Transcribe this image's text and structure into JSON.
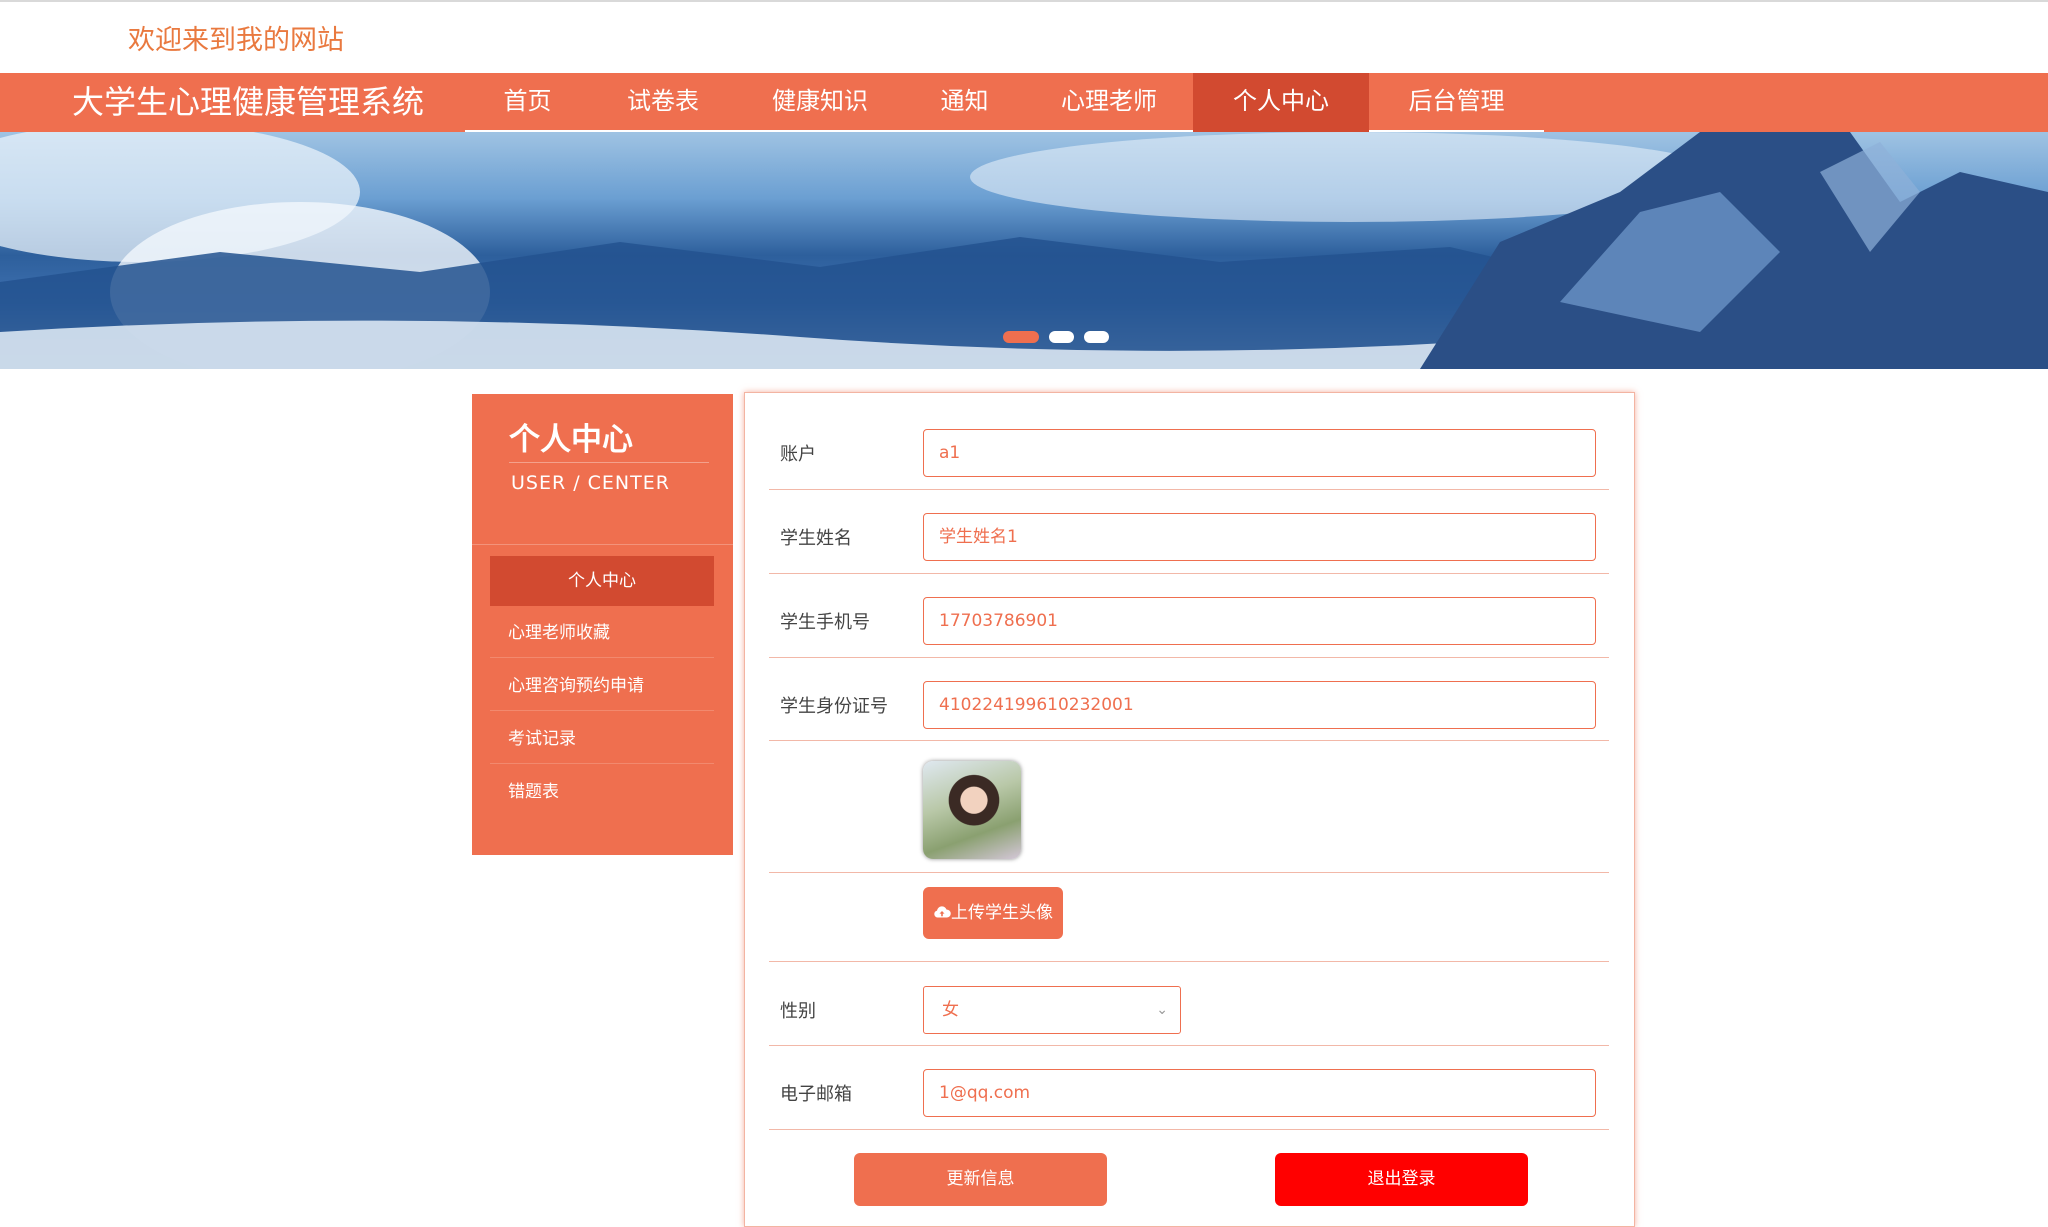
{
  "header": {
    "welcome": "欢迎来到我的网站",
    "system_title": "大学生心理健康管理系统"
  },
  "nav": {
    "items": [
      {
        "label": "首页"
      },
      {
        "label": "试卷表"
      },
      {
        "label": "健康知识"
      },
      {
        "label": "通知"
      },
      {
        "label": "心理老师"
      },
      {
        "label": "个人中心",
        "active": true
      },
      {
        "label": "后台管理"
      }
    ]
  },
  "banner": {
    "slides_count": 3,
    "active_slide": 1
  },
  "sidebar": {
    "title": "个人中心",
    "subtitle": "USER / CENTER",
    "items": [
      {
        "label": "个人中心",
        "active": true
      },
      {
        "label": "心理老师收藏"
      },
      {
        "label": "心理咨询预约申请"
      },
      {
        "label": "考试记录"
      },
      {
        "label": "错题表"
      }
    ]
  },
  "form": {
    "account": {
      "label": "账户",
      "value": "a1"
    },
    "name": {
      "label": "学生姓名",
      "value": "学生姓名1"
    },
    "phone": {
      "label": "学生手机号",
      "value": "17703786901"
    },
    "id_card": {
      "label": "学生身份证号",
      "value": "410224199610232001"
    },
    "upload_label": "上传学生头像",
    "gender": {
      "label": "性别",
      "value": "女"
    },
    "email": {
      "label": "电子邮箱",
      "value": "1@qq.com"
    },
    "update_button": "更新信息",
    "logout_button": "退出登录"
  },
  "colors": {
    "primary": "#ef6f4f",
    "primary_dark": "#d24a30",
    "logout": "#ff0000",
    "welcome_text": "#e9793f"
  }
}
